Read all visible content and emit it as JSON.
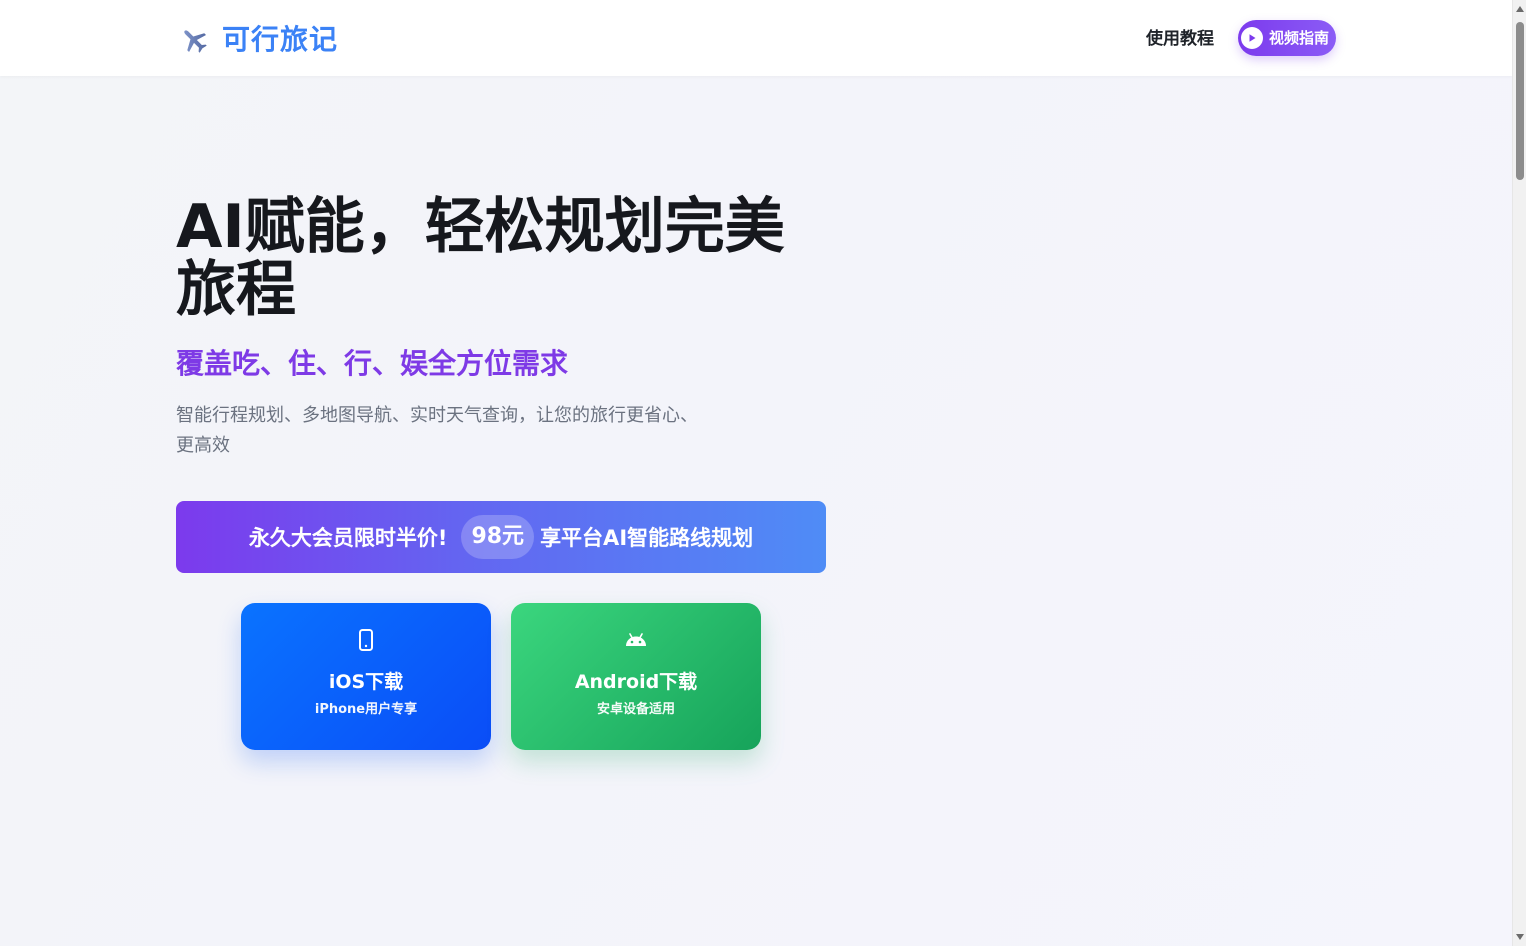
{
  "header": {
    "brand_icon": "airplane-icon",
    "brand_name": "可行旅记",
    "nav_tutorial": "使用教程",
    "video_button": {
      "icon": "play-icon",
      "label": "视频指南",
      "color": "#7c3aed"
    }
  },
  "hero": {
    "title": "AI赋能，轻松规划完美旅程",
    "subtitle": "覆盖吃、住、行、娱全方位需求",
    "description": "智能行程规划、多地图导航、实时天气查询，让您的旅行更省心、更高效",
    "subtitle_color": "#7e3ae6"
  },
  "promo": {
    "pre_text": "永久大会员限时半价!",
    "price": "98元",
    "post_text": "享平台AI智能路线规划"
  },
  "downloads": {
    "ios": {
      "icon": "mobile-phone-icon",
      "title": "iOS下载",
      "note": "iPhone用户专享",
      "color": "#0a5cfb"
    },
    "android": {
      "icon": "android-icon",
      "title": "Android下载",
      "note": "安卓设备适用",
      "color": "#22b866"
    }
  }
}
